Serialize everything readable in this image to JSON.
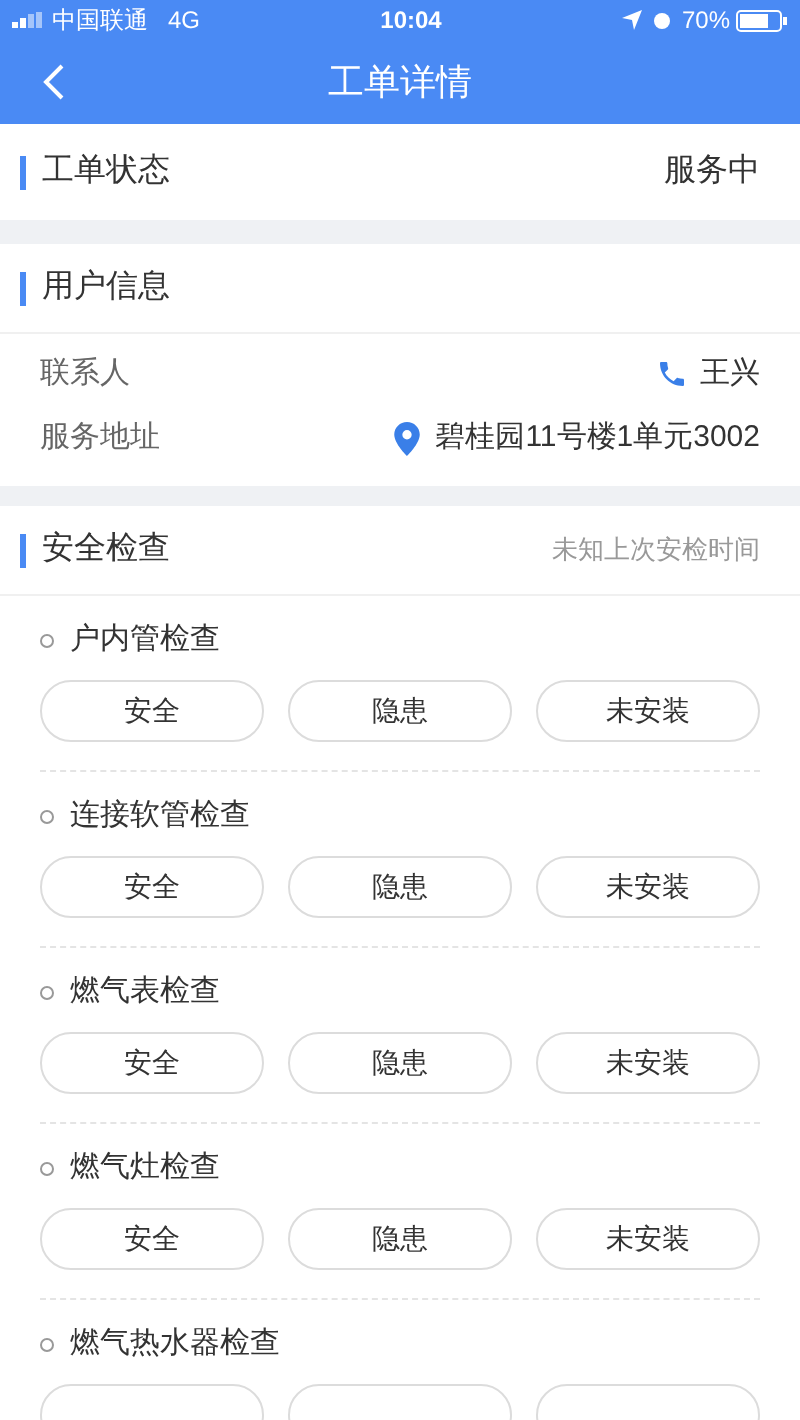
{
  "status_bar": {
    "carrier": "中国联通",
    "network": "4G",
    "time": "10:04",
    "battery": "70%"
  },
  "nav": {
    "title": "工单详情"
  },
  "order_status": {
    "label": "工单状态",
    "value": "服务中"
  },
  "user_info": {
    "title": "用户信息",
    "contact_label": "联系人",
    "contact": "王兴",
    "address_label": "服务地址",
    "address": "碧桂园11号楼1单元3002"
  },
  "safety": {
    "title": "安全检查",
    "note": "未知上次安检时间",
    "items": [
      {
        "name": "户内管检查",
        "options": [
          {
            "label": "安全",
            "selected": false
          },
          {
            "label": "隐患",
            "selected": false
          },
          {
            "label": "未安装",
            "selected": false
          }
        ]
      },
      {
        "name": "连接软管检查",
        "options": [
          {
            "label": "安全",
            "selected": false
          },
          {
            "label": "隐患",
            "selected": false
          },
          {
            "label": "未安装",
            "selected": false
          }
        ]
      },
      {
        "name": "燃气表检查",
        "options": [
          {
            "label": "安全",
            "selected": false
          },
          {
            "label": "隐患",
            "selected": false
          },
          {
            "label": "未安装",
            "selected": false
          }
        ]
      },
      {
        "name": "燃气灶检查",
        "options": [
          {
            "label": "安全",
            "selected": false
          },
          {
            "label": "隐患",
            "selected": false
          },
          {
            "label": "未安装",
            "selected": false
          }
        ]
      },
      {
        "name": "燃气热水器检查",
        "options": [
          {
            "selected": false
          },
          {
            "selected": false
          },
          {
            "selected": false
          }
        ]
      }
    ]
  }
}
